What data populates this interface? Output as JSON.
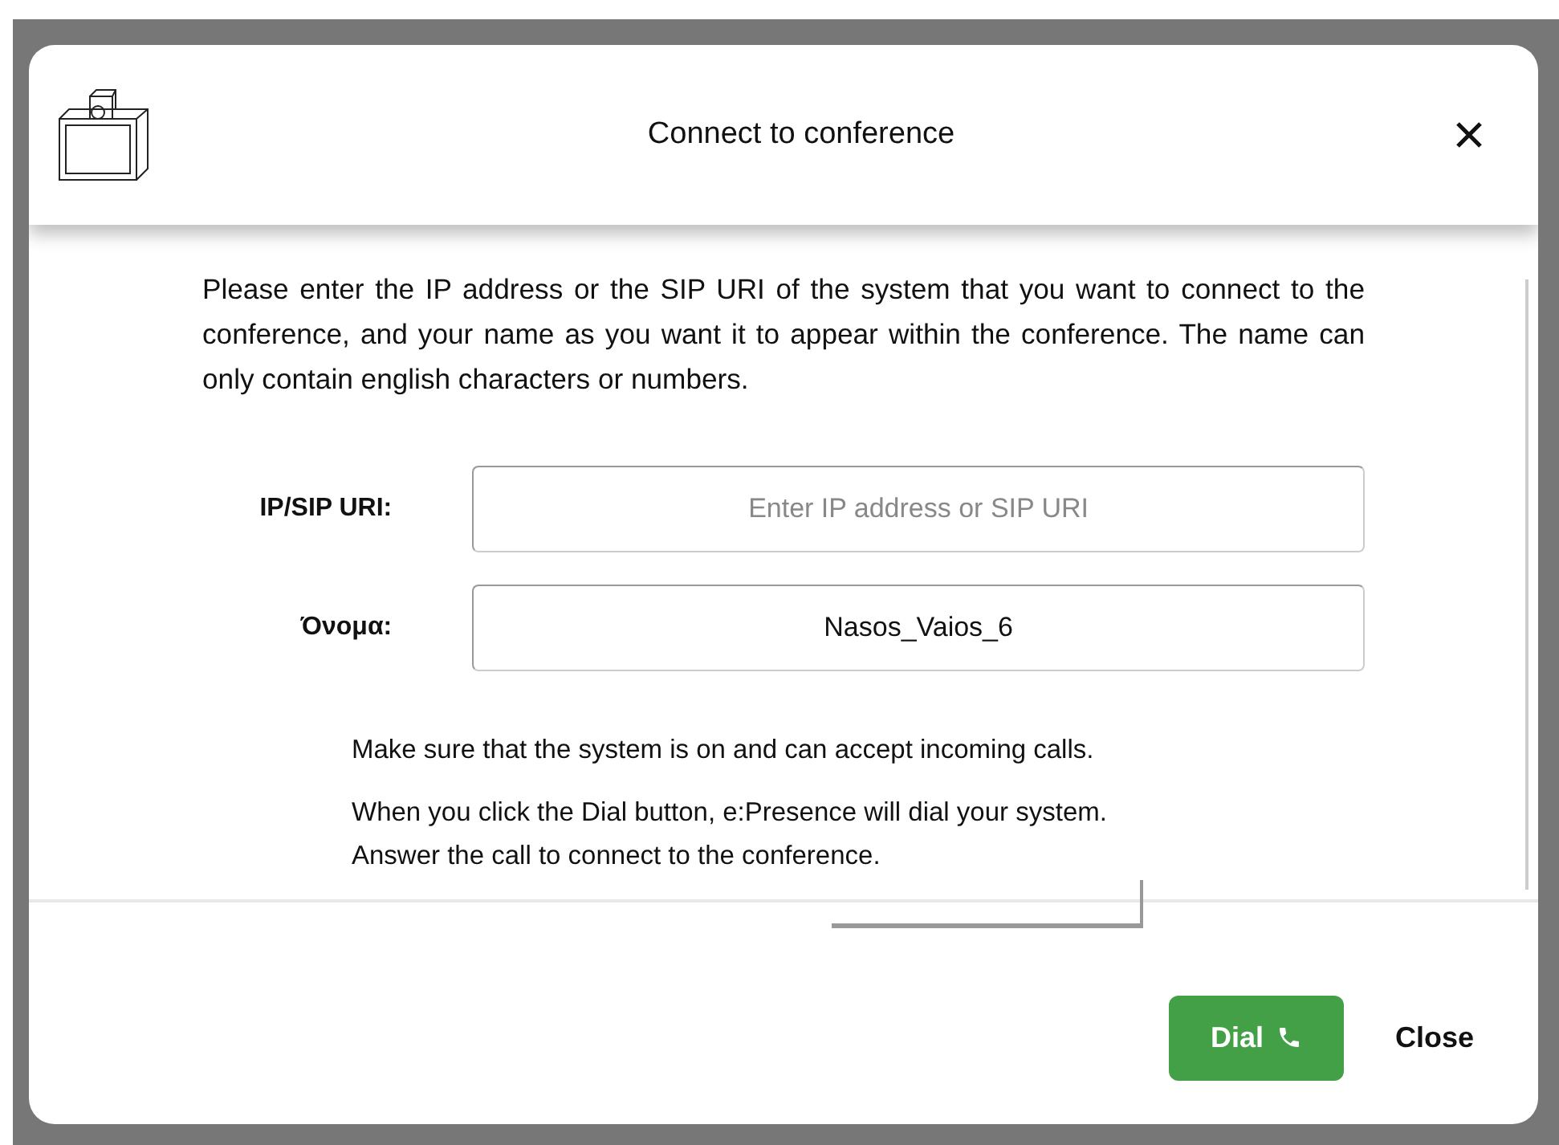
{
  "dialog": {
    "title": "Connect to conference",
    "intro": "Please enter the IP address or the SIP URI of the system that you want to connect to the conference, and your name as you want it to appear within the conference. The name can only contain english characters or numbers.",
    "fields": [
      {
        "label": "IP/SIP URI:",
        "placeholder": "Enter IP address or SIP URI"
      },
      {
        "label": "Όνομα:",
        "value": "Nasos_Vaios_6"
      }
    ],
    "notes": [
      "Make sure that the system is on and can accept incoming calls.",
      "When you click the Dial button, e:Presence will dial your system.\nAnswer the call to connect to the conference."
    ],
    "buttons": [
      {
        "label": "Dial",
        "kind": "primary"
      },
      {
        "label": "Close",
        "kind": "plain"
      }
    ]
  }
}
